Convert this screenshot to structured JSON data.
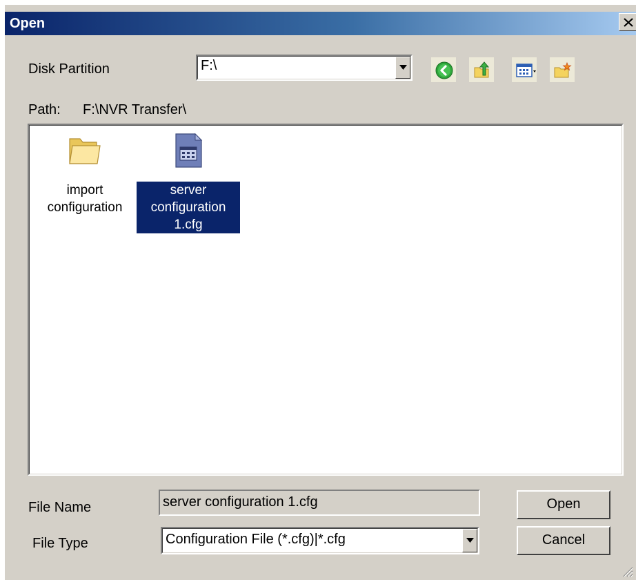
{
  "window": {
    "title": "Open"
  },
  "toolbar": {
    "disk_partition_label": "Disk Partition",
    "disk_partition_value": "F:\\",
    "icons": [
      "back-icon",
      "up-folder-icon",
      "view-menu-icon",
      "new-folder-icon"
    ]
  },
  "path": {
    "label": "Path:",
    "value": "F:\\NVR Transfer\\"
  },
  "files": [
    {
      "line1": "import",
      "line2": "configuration",
      "line3": "",
      "type": "folder",
      "selected": false
    },
    {
      "line1": "server",
      "line2": "configuration",
      "line3": "1.cfg",
      "type": "cfg-file",
      "selected": true
    }
  ],
  "form": {
    "file_name_label": "File Name",
    "file_name_value": "server configuration 1.cfg",
    "file_type_label": "File Type",
    "file_type_value": "Configuration File (*.cfg)|*.cfg"
  },
  "buttons": {
    "open": "Open",
    "cancel": "Cancel"
  },
  "colors": {
    "title_bar_start": "#0a246a",
    "title_bar_end": "#a6caf0",
    "selection": "#0a246a",
    "face": "#d4d0c8"
  }
}
